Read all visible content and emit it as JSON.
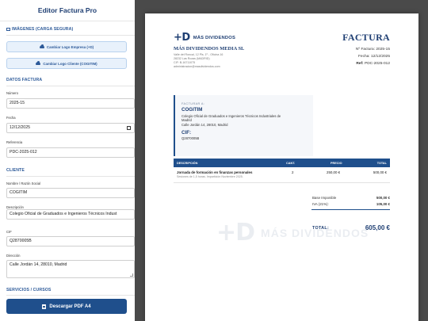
{
  "sidebar": {
    "title": "Editor Factura Pro",
    "images_section": "IMÁGENES (CARGA SEGURA)",
    "btn_company_logo": "Cambiar Logo Empresa (+D)",
    "btn_client_logo": "Cambiar Logo Cliente (COGITIM)",
    "invoice_section": "DATOS FACTURA",
    "number_label": "Número",
    "number_value": "2025-15",
    "date_label": "Fecha",
    "date_value": "12/12/2025",
    "ref_label": "Referencia",
    "ref_value": "PDC-2025-012",
    "client_section": "CLIENTE",
    "client_name_label": "Nombre / Razón Social",
    "client_name_value": "COGITIM",
    "client_desc_label": "Descripción",
    "client_desc_value": "Colegio Oficial de Graduados e Ingenieros Técnicos Indust",
    "cif_label": "CIF",
    "cif_value": "Q2870005B",
    "address_label": "Dirección",
    "address_value": "Calle Jordán 14, 28010, Madrid",
    "services_section": "SERVICIOS / CURSOS",
    "download_button": "Descargar PDF A4"
  },
  "invoice": {
    "brand_mark": "+D",
    "brand_name": "MÁS DIVIDENDOS",
    "company_name": "MÁS DIVIDENDOS MEDIA SL",
    "company_lines": [
      "Valle del Roncal, 12 Pls. 1º - Oficina 16",
      "28232 Las Rozas (MADRID)",
      "CIF: B-16711075",
      "administracion@masdividendos.com"
    ],
    "title": "FACTURA",
    "number_label": "Nº Factura:",
    "number_value": "2025-15",
    "date_label": "Fecha:",
    "date_value": "12/12/2025",
    "ref_label": "Ref:",
    "ref_value": "PDC-2025-012",
    "client_tag": "FACTURAR A:",
    "client_name": "COGITIM",
    "client_desc_1": "Colegio Oficial de Graduados e Ingenieros Técnicos Industriales de",
    "client_desc_2": "Madrid",
    "client_address": "Calle Jordán 14, 28010, Madrid",
    "cif_label": "CIF:",
    "cif_value": "Q2870005B",
    "table_headers": [
      "DESCRIPCIÓN",
      "CANT.",
      "PRECIO",
      "TOTAL"
    ],
    "rows": [
      {
        "description": "Jornada de formación en finanzas personales",
        "subtitle": "Sesiones de 1,5 horas. Impartición Noviembre 2025.",
        "qty": "2",
        "price": "250,00 €",
        "total": "500,00 €"
      }
    ],
    "base_label": "Base Imponible",
    "base_value": "500,00 €",
    "iva_label": "IVA (21%):",
    "iva_value": "105,00 €",
    "total_label": "TOTAL:",
    "total_value": "605,00 €",
    "watermark_mark": "+D",
    "watermark_text": "MÁS DIVIDENDOS"
  }
}
